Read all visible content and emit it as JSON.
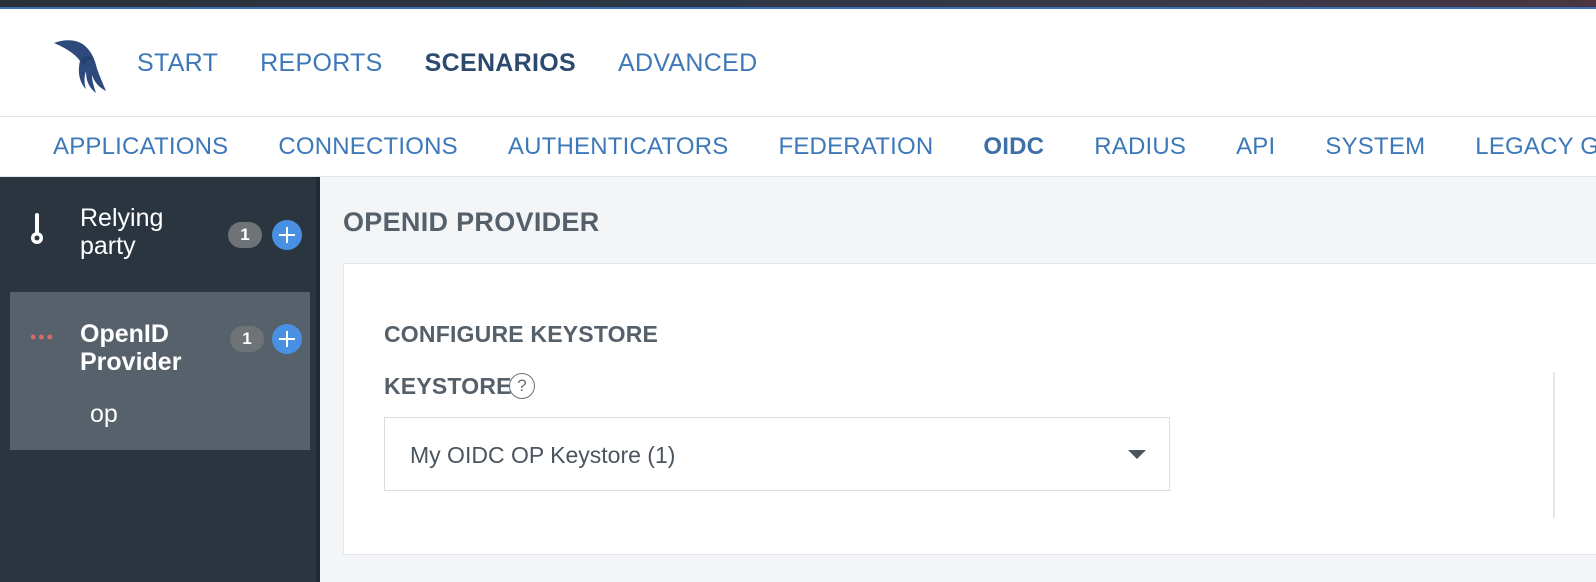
{
  "main_nav": {
    "items": [
      "START",
      "REPORTS",
      "SCENARIOS",
      "ADVANCED"
    ],
    "active": "SCENARIOS"
  },
  "sub_nav": {
    "items": [
      "APPLICATIONS",
      "CONNECTIONS",
      "AUTHENTICATORS",
      "FEDERATION",
      "OIDC",
      "RADIUS",
      "API",
      "SYSTEM",
      "LEGACY GUIDES"
    ],
    "active": "OIDC"
  },
  "sidebar": {
    "items": [
      {
        "label": "Relying party",
        "count": "1",
        "icon": "key-icon"
      },
      {
        "label": "OpenID Provider",
        "count": "1",
        "icon": "dots-icon",
        "children": [
          "op"
        ]
      }
    ]
  },
  "main": {
    "page_title": "OPENID PROVIDER",
    "section_title": "CONFIGURE KEYSTORE",
    "field_label": "KEYSTORE",
    "help_glyph": "?",
    "keystore_value": "My OIDC OP Keystore (1)"
  },
  "colors": {
    "link_blue": "#3d78b8",
    "active_nav": "#2c4a6e",
    "sidebar_bg": "#2b3540",
    "sidebar_active_bg": "#56616c",
    "add_button": "#4a90e2",
    "badge": "#6e7377"
  }
}
